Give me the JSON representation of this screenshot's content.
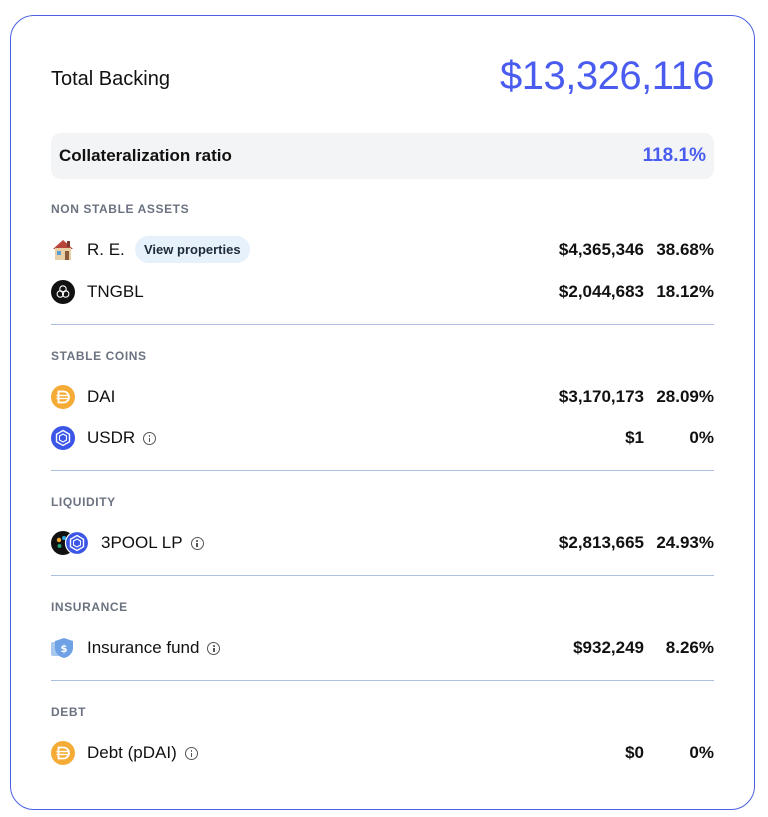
{
  "header": {
    "title": "Total Backing",
    "value": "$13,326,116"
  },
  "ratio": {
    "label": "Collateralization ratio",
    "value": "118.1%"
  },
  "sections": {
    "non_stable": {
      "title": "NON STABLE ASSETS",
      "rows": [
        {
          "name": "R. E.",
          "action": "View properties",
          "amount": "$4,365,346",
          "pct": "38.68%",
          "icon": "house-icon"
        },
        {
          "name": "TNGBL",
          "amount": "$2,044,683",
          "pct": "18.12%",
          "icon": "tngbl-icon"
        }
      ]
    },
    "stable": {
      "title": "STABLE COINS",
      "rows": [
        {
          "name": "DAI",
          "amount": "$3,170,173",
          "pct": "28.09%",
          "icon": "dai-icon"
        },
        {
          "name": "USDR",
          "amount": "$1",
          "pct": "0%",
          "icon": "usdr-icon"
        }
      ]
    },
    "liquidity": {
      "title": "LIQUIDITY",
      "rows": [
        {
          "name": "3POOL LP",
          "amount": "$2,813,665",
          "pct": "24.93%",
          "icon": "3pool-icon"
        }
      ]
    },
    "insurance": {
      "title": "INSURANCE",
      "rows": [
        {
          "name": "Insurance fund",
          "amount": "$932,249",
          "pct": "8.26%",
          "icon": "shield-dollar-icon"
        }
      ]
    },
    "debt": {
      "title": "DEBT",
      "rows": [
        {
          "name": "Debt (pDAI)",
          "amount": "$0",
          "pct": "0%",
          "icon": "pdai-icon"
        }
      ]
    }
  },
  "colors": {
    "accent": "#4a5cf0",
    "border": "#4a61e4",
    "divider": "#aac0dc",
    "dai": "#f5ac37",
    "usdr": "#3b55e6"
  }
}
